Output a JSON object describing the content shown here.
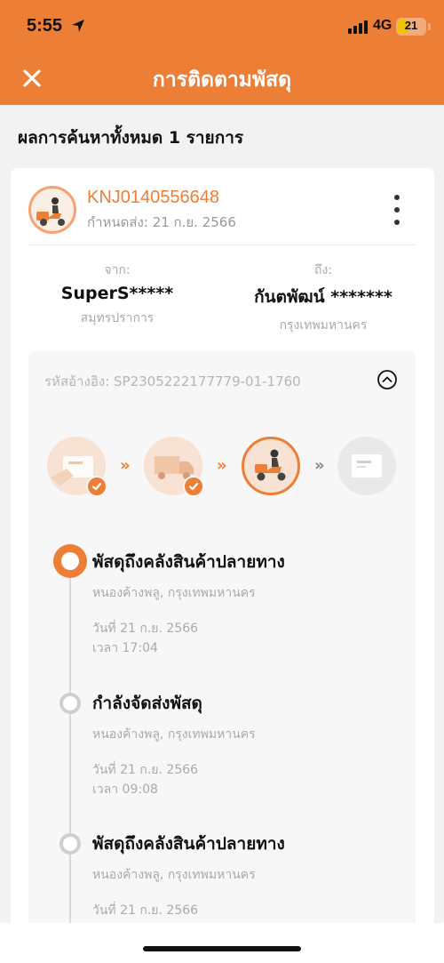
{
  "status_bar": {
    "time": "5:55",
    "network": "4G",
    "battery": "21",
    "icons": [
      "location-arrow-icon",
      "signal-icon",
      "battery-icon"
    ]
  },
  "header": {
    "title": "การติดตามพัสดุ",
    "close_icon": "close-icon"
  },
  "results_label": "ผลการค้นหาทั้งหมด 1 รายการ",
  "parcel": {
    "tracking_number": "KNJ0140556648",
    "due_date": "กำหนดส่ง: 21 ก.ย. 2566",
    "accent_color": "#ed7e36",
    "from": {
      "label": "จาก:",
      "name": "SuperS*****",
      "place": "สมุทรปราการ"
    },
    "to": {
      "label": "ถึง:",
      "name": "กันตพัฒน์ *******",
      "place": "กรุงเทพมหานคร"
    },
    "reference": "รหัสอ้างอิง: SP2305222177779-01-1760",
    "progress_steps": [
      {
        "name": "parcel-created",
        "status": "done"
      },
      {
        "name": "in-transit-truck",
        "status": "done"
      },
      {
        "name": "out-for-delivery",
        "status": "current"
      },
      {
        "name": "delivered",
        "status": "todo"
      }
    ],
    "chevron": "»",
    "events": [
      {
        "title": "พัสดุถึงคลังสินค้าปลายทาง",
        "place": "หนองค้างพลู, กรุงเทพมหานคร",
        "date": "วันที่ 21 ก.ย. 2566",
        "time": "เวลา 17:04"
      },
      {
        "title": "กำลังจัดส่งพัสดุ",
        "place": "หนองค้างพลู, กรุงเทพมหานคร",
        "date": "วันที่ 21 ก.ย. 2566",
        "time": "เวลา 09:08"
      },
      {
        "title": "พัสดุถึงคลังสินค้าปลายทาง",
        "place": "หนองค้างพลู, กรุงเทพมหานคร",
        "date": "วันที่ 21 ก.ย. 2566"
      }
    ]
  }
}
